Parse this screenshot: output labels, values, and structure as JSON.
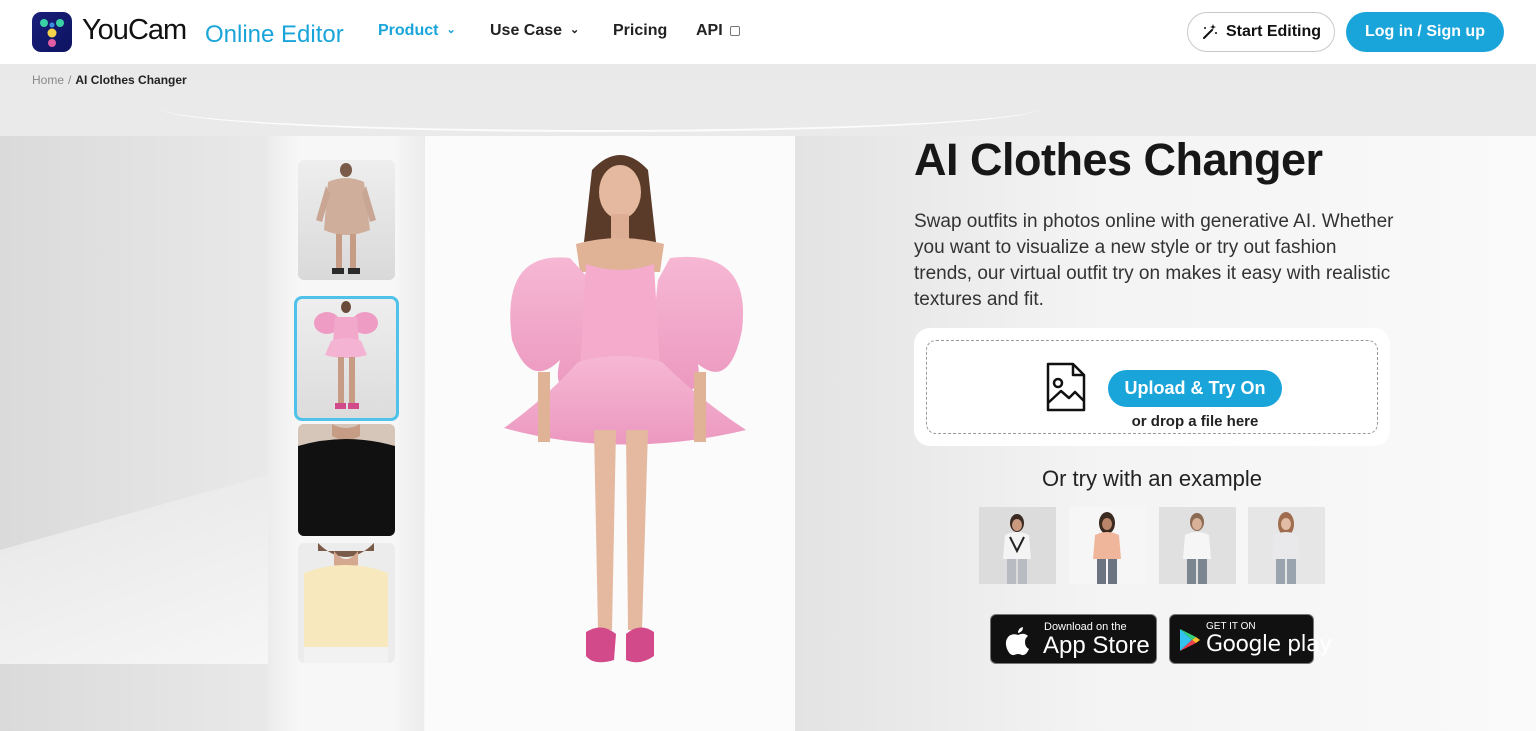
{
  "header": {
    "logo_word": "YouCam",
    "logo_sub": "Online Editor",
    "nav": [
      {
        "label": "Product"
      },
      {
        "label": "Use Case"
      },
      {
        "label": "Pricing"
      },
      {
        "label": "API"
      }
    ],
    "start_editing": "Start Editing",
    "login": "Log in / Sign up"
  },
  "breadcrumb": {
    "home": "Home",
    "sep": "/",
    "current": "AI Clothes Changer"
  },
  "hero": {
    "title": "AI Clothes Changer",
    "description": "Swap outfits in photos online with generative AI. Whether you want to visualize a new style or try out fashion trends, our virtual outfit try on makes it easy with realistic textures and fit.",
    "upload_button": "Upload & Try On",
    "drop_text": "or drop a file here",
    "example_heading": "Or try with an example"
  },
  "stores": {
    "appstore_small": "Download on the",
    "appstore_big": "App Store",
    "google_small": "GET IT ON",
    "google_big": "Google play"
  },
  "colors": {
    "accent": "#1aa5da",
    "selected_thumb_border": "#4ec2e8"
  },
  "icons": [
    "chevron-down-icon",
    "external-link-icon",
    "magic-wand-icon",
    "image-upload-icon",
    "apple-icon",
    "google-play-icon"
  ]
}
